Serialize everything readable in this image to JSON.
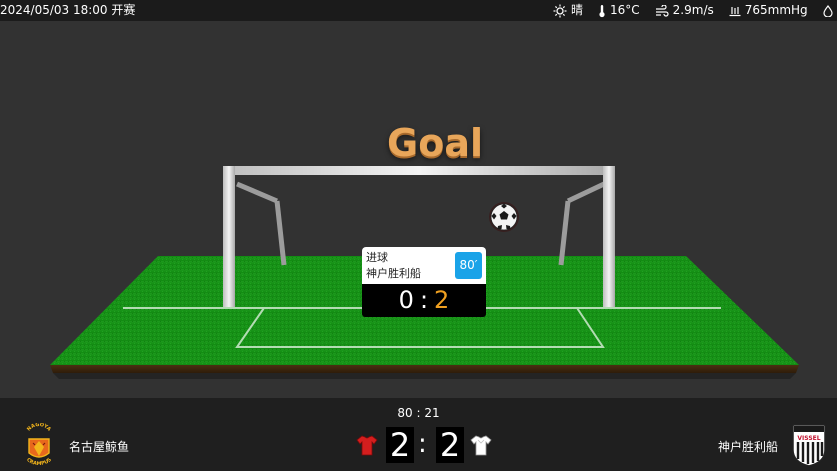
{
  "header": {
    "match_time": "2024/05/03 18:00 开赛",
    "weather": {
      "condition": "晴",
      "temperature": "16°C",
      "wind": "2.9m/s",
      "pressure": "765mmHg",
      "cut_off_value": "4"
    }
  },
  "stage": {
    "event_title": "Goal",
    "event": {
      "type": "进球",
      "team": "神户胜利船",
      "minute": "80′",
      "score_home": "0",
      "score_separator": ":",
      "score_away": "2"
    }
  },
  "footer": {
    "clock": "80 : 21",
    "home_team": "名古屋鲸鱼",
    "away_team": "神户胜利船",
    "home_score": "2",
    "away_score": "2",
    "score_separator": ":",
    "home_logo_text_top": "NAGOYA",
    "home_logo_text_bottom": "CRAMPUS",
    "away_logo_text": "VISSEL"
  },
  "colors": {
    "accent_orange": "#e8a65a",
    "minute_badge": "#1aa3e8",
    "away_score": "#f0a020",
    "home_shirt": "#d41e1e",
    "away_shirt": "#ffffff",
    "pitch_green": "#139b13"
  },
  "icons": {
    "sun": "sun-icon",
    "thermometer": "thermometer-icon",
    "wind": "wind-icon",
    "pressure": "pressure-icon",
    "drop": "drop-icon",
    "ball": "football-icon",
    "home_shirt": "home-shirt-icon",
    "away_shirt": "away-shirt-icon"
  }
}
